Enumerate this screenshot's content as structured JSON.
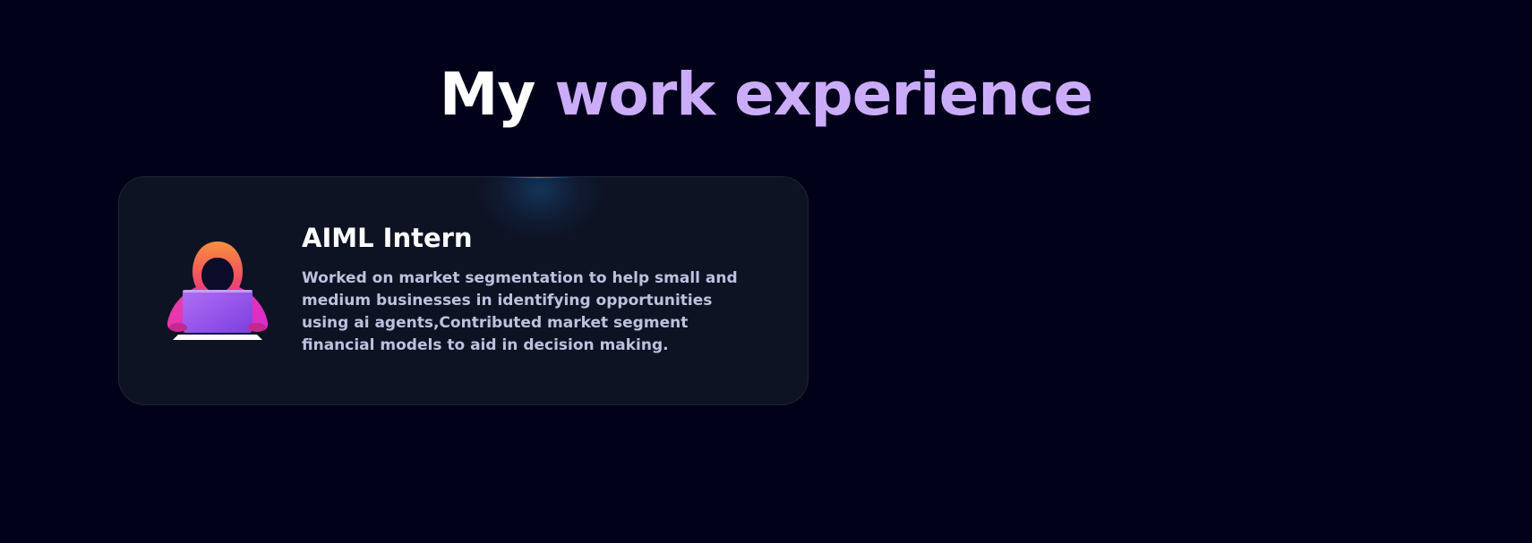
{
  "heading": {
    "prefix": "My",
    "highlight": "work experience"
  },
  "colors": {
    "background": "#01021a",
    "card": "#0e1324",
    "accent": "#cbacf9",
    "title": "#ffffff",
    "description": "#bec1dd"
  },
  "experiences": [
    {
      "title": "AIML Intern",
      "description": "Worked on market segmentation to help small and medium businesses in identifying opportunities using ai agents,Contributed market segment financial models to aid in decision making.",
      "thumbnail_icon": "hooded-hacker-laptop-icon"
    }
  ]
}
